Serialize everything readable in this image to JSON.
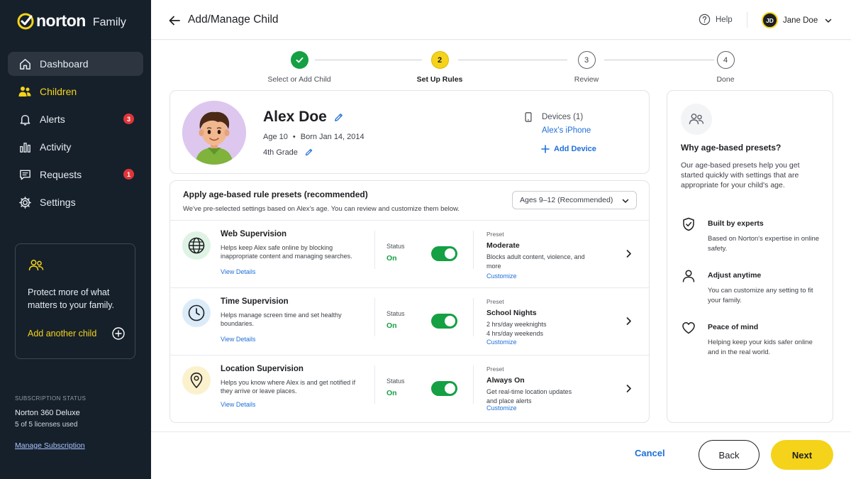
{
  "app": {
    "brand": "norton",
    "product": "Family",
    "accent_color": "#f5d31a",
    "sidebar_bg": "#16202b",
    "success_color": "#14a043",
    "link_color": "#1e6fd9"
  },
  "sidebar": {
    "items": [
      {
        "label": "Dashboard",
        "icon": "home-icon",
        "active": true
      },
      {
        "label": "Children",
        "icon": "children-icon",
        "highlight": true
      },
      {
        "label": "Alerts",
        "icon": "bell-icon",
        "badge": "3"
      },
      {
        "label": "Activity",
        "icon": "bar-chart-icon"
      },
      {
        "label": "Requests",
        "icon": "chat-icon",
        "badge": "1"
      },
      {
        "label": "Settings",
        "icon": "gear-icon"
      }
    ],
    "promo": {
      "text": "Protect more of what matters to your family.",
      "add_label": "Add another child"
    },
    "subscription": {
      "caption": "SUBSCRIPTION STATUS",
      "plan": "Norton 360 Deluxe",
      "licenses": "5 of 5 licenses used",
      "manage_label": "Manage Subscription"
    }
  },
  "header": {
    "title": "Add/Manage Child",
    "help_label": "Help",
    "user_initials": "JD",
    "user_name": "Jane Doe"
  },
  "stepper": [
    {
      "number": "1",
      "label": "Select or Add Child",
      "state": "done"
    },
    {
      "number": "2",
      "label": "Set Up Rules",
      "state": "current"
    },
    {
      "number": "3",
      "label": "Review",
      "state": "todo"
    },
    {
      "number": "4",
      "label": "Done",
      "state": "todo"
    }
  ],
  "profile": {
    "name": "Alex Doe",
    "age": "Age 10",
    "born": "Born Jan 14, 2014",
    "grade": "4th Grade",
    "devices_label": "Devices (1)",
    "device_name": "Alex's iPhone",
    "add_device_label": "Add Device"
  },
  "rules": {
    "title": "Apply age-based rule presets (recommended)",
    "subtitle": "We've pre-selected settings based on Alex's age. You can review and customize them below.",
    "age_select": "Ages 9–12 (Recommended)",
    "items": [
      {
        "name": "Web Supervision",
        "icon": "globe-icon",
        "icon_bg": "#dff3e4",
        "description": "Helps keep Alex safe online by blocking inappropriate content and managing searches.",
        "view_label": "View Details",
        "status_caption": "Status",
        "status": "On",
        "preset_caption": "Preset",
        "preset_name": "Moderate",
        "preset_description": "Blocks adult content, violence, and more",
        "customize_label": "Customize"
      },
      {
        "name": "Time Supervision",
        "icon": "clock-icon",
        "icon_bg": "#dcebf8",
        "description": "Helps manage screen time and set healthy boundaries.",
        "view_label": "View Details",
        "status_caption": "Status",
        "status": "On",
        "preset_caption": "Preset",
        "preset_name": "School Nights",
        "preset_description": "2 hrs/day weeknights\n4 hrs/day weekends",
        "customize_label": "Customize"
      },
      {
        "name": "Location Supervision",
        "icon": "location-pin-icon",
        "icon_bg": "#fbf1cc",
        "description": "Helps you know where Alex is and get notified if they arrive or leave places.",
        "view_label": "View Details",
        "status_caption": "Status",
        "status": "On",
        "preset_caption": "Preset",
        "preset_name": "Always On",
        "preset_description": "Get real-time location updates and place alerts",
        "customize_label": "Customize"
      }
    ]
  },
  "why_panel": {
    "title": "Why age-based presets?",
    "description": "Our age-based presets help you get started quickly with settings that are appropriate for your child's age.",
    "features": [
      {
        "icon": "shield-check-icon",
        "title": "Built by experts",
        "description": "Based on Norton's expertise in online safety."
      },
      {
        "icon": "person-icon",
        "title": "Adjust anytime",
        "description": "You can customize any setting to fit your family."
      },
      {
        "icon": "heart-icon",
        "title": "Peace of mind",
        "description": "Helping keep your kids safer online and in the real world."
      }
    ]
  },
  "footer": {
    "cancel_label": "Cancel",
    "back_label": "Back",
    "next_label": "Next"
  }
}
